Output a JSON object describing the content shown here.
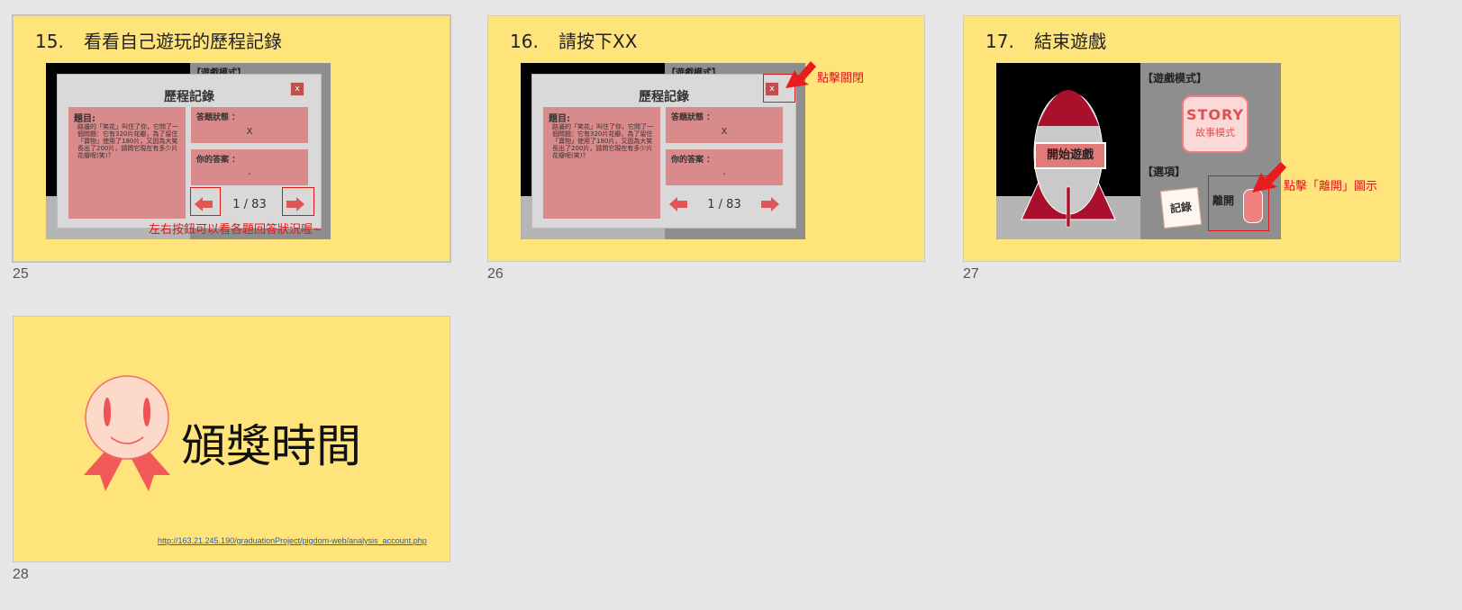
{
  "slides": [
    {
      "number": "25",
      "title_num": "15.",
      "title": "看看自己遊玩的歷程記錄",
      "peek_label": "【遊戲模式】",
      "dialog": {
        "title": "歷程記錄",
        "close": "x",
        "question_label": "題目:",
        "question_text": "路邊的「笑花」叫住了你，它問了一個問題：它有320片花瓣，為了留住「寶物」使用了180片，又因為大笑長出了200片，請問它現在有多少片花瓣呢(笑)？",
        "status_label": "答題狀態 ：",
        "status_value": "X",
        "answer_label": "你的答案 ：",
        "answer_value": "-",
        "pager": "1 / 83"
      },
      "note": "左右按鈕可以看各題回答狀況喔~"
    },
    {
      "number": "26",
      "title_num": "16.",
      "title": "請按下XX",
      "peek_label": "【遊戲模式】",
      "dialog": {
        "title": "歷程記錄",
        "close": "x",
        "question_label": "題目:",
        "question_text": "路邊的「笑花」叫住了你，它問了一個問題：它有320片花瓣，為了留住「寶物」使用了180片，又因為大笑長出了200片，請問它現在有多少片花瓣呢(笑)？",
        "status_label": "答題狀態 ：",
        "status_value": "X",
        "answer_label": "你的答案 ：",
        "answer_value": "-",
        "pager": "1 / 83"
      },
      "note": "點擊關閉"
    },
    {
      "number": "27",
      "title_num": "17.",
      "title": "結束遊戲",
      "start_button": "開始遊戲",
      "mode_label": "【遊戲模式】",
      "story_big": "STORY",
      "story_small": "故事模式",
      "options_label": "【選項】",
      "record_button": "記錄",
      "leave_label": "離開",
      "note": "點擊「離開」圖示"
    },
    {
      "number": "28",
      "title": "頒獎時間",
      "link": "http://163.21.245.190/graduationProject/pigdom-web/analysis_account.php"
    }
  ],
  "colors": {
    "slide_bg": "#ffe47c",
    "annotation_red": "#d91a1a",
    "panel_pink": "#d98a8a",
    "app_bg": "#e6e6e6"
  }
}
